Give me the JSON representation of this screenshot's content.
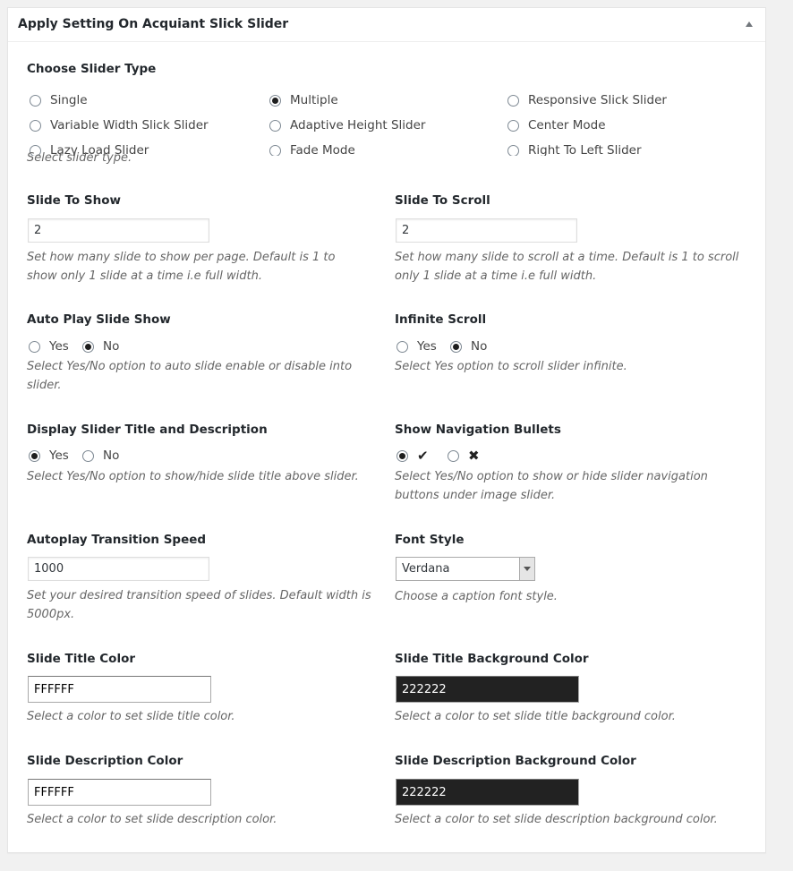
{
  "panel": {
    "title": "Apply Setting On Acquiant Slick Slider"
  },
  "slider_type": {
    "label": "Choose Slider Type",
    "options": [
      {
        "label": "Single",
        "checked": false
      },
      {
        "label": "Multiple",
        "checked": true
      },
      {
        "label": "Responsive Slick Slider",
        "checked": false
      },
      {
        "label": "Variable Width Slick Slider",
        "checked": false
      },
      {
        "label": "Adaptive Height Slider",
        "checked": false
      },
      {
        "label": "Center Mode",
        "checked": false
      },
      {
        "label": "Lazy Load Slider",
        "checked": false
      },
      {
        "label": "Fade Mode",
        "checked": false
      },
      {
        "label": "Right To Left Slider",
        "checked": false
      }
    ],
    "description": "Select slider type."
  },
  "slide_to_show": {
    "label": "Slide To Show",
    "value": "2",
    "description": "Set how many slide to show per page. Default is 1 to show only 1 slide at a time i.e full width."
  },
  "slide_to_scroll": {
    "label": "Slide To Scroll",
    "value": "2",
    "description": "Set how many slide to scroll at a time. Default is 1 to scroll only 1 slide at a time i.e full width."
  },
  "auto_play": {
    "label": "Auto Play Slide Show",
    "yes": "Yes",
    "no": "No",
    "selected": "No",
    "description": "Select Yes/No option to auto slide enable or disable into slider."
  },
  "infinite_scroll": {
    "label": "Infinite Scroll",
    "yes": "Yes",
    "no": "No",
    "selected": "No",
    "description": "Select Yes option to scroll slider infinite."
  },
  "display_title": {
    "label": "Display Slider Title and Description",
    "yes": "Yes",
    "no": "No",
    "selected": "Yes",
    "description": "Select Yes/No option to show/hide slide title above slider."
  },
  "nav_bullets": {
    "label": "Show Navigation Bullets",
    "yes_icon": "checkmark-icon",
    "no_icon": "cross-icon",
    "selected": "Yes",
    "description": "Select Yes/No option to show or hide slider navigation buttons under image slider."
  },
  "transition_speed": {
    "label": "Autoplay Transition Speed",
    "value": "1000",
    "description": "Set your desired transition speed of slides. Default width is 5000px."
  },
  "font_style": {
    "label": "Font Style",
    "value": "Verdana",
    "description": "Choose a caption font style."
  },
  "title_color": {
    "label": "Slide Title Color",
    "value": "FFFFFF",
    "swatch": "#FFFFFF",
    "description": "Select a color to set slide title color."
  },
  "title_bg_color": {
    "label": "Slide Title Background Color",
    "value": "222222",
    "swatch": "#222222",
    "description": "Select a color to set slide title background color."
  },
  "desc_color": {
    "label": "Slide Description Color",
    "value": "FFFFFF",
    "swatch": "#FFFFFF",
    "description": "Select a color to set slide description color."
  },
  "desc_bg_color": {
    "label": "Slide Description Background Color",
    "value": "222222",
    "swatch": "#222222",
    "description": "Select a color to set slide description background color."
  }
}
